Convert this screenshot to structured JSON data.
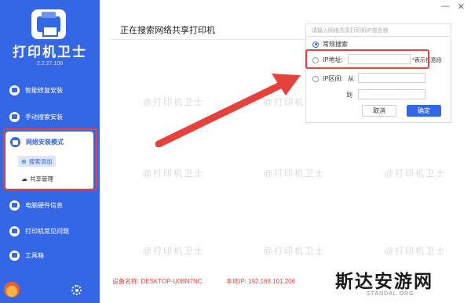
{
  "app": {
    "title": "打印机卫士",
    "version": "2.2.27.108"
  },
  "window_controls": {
    "minimize": "—",
    "close": "✕"
  },
  "sidebar": {
    "items": [
      {
        "label": "智能修复安装",
        "icon": "repair-icon"
      },
      {
        "label": "手动搜索安装",
        "icon": "tools-icon"
      },
      {
        "label": "网络安装模式",
        "icon": "network-icon"
      },
      {
        "label": "电脑硬件信息",
        "icon": "hardware-icon"
      },
      {
        "label": "打印机常见问题",
        "icon": "printer-icon"
      },
      {
        "label": "工具箱",
        "icon": "toolbox-icon"
      }
    ],
    "sub_items": [
      {
        "label": "搜索添加",
        "icon": "search-add-icon"
      },
      {
        "label": "共享管理",
        "icon": "cloud-icon"
      }
    ]
  },
  "main": {
    "title": "正在搜索网络共享打印机"
  },
  "search": {
    "placeholder": "请输入网络共享打印机IP或名称",
    "options": {
      "normal": "常规搜索",
      "ip_label": "IP地址:",
      "ip_note": "*表示任意段",
      "range_label": "IP区间:",
      "from_label": "从",
      "to_label": "到"
    },
    "selected": "常规搜索",
    "cancel_label": "取消",
    "ok_label": "确定"
  },
  "status": {
    "device_label": "设备名称:",
    "device_name": "DESKTOP-U0BN7NC",
    "ip_label": "本地IP:",
    "ip": "192.168.101.206"
  },
  "watermark": {
    "text": "@打印机卫士",
    "brand": "斯达安游网",
    "domain": "STANDAL.ORG"
  },
  "colors": {
    "accent": "#3467e6",
    "highlight": "#e8403a"
  }
}
